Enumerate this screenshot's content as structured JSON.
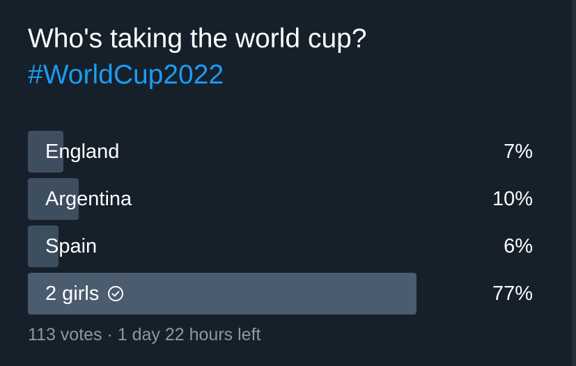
{
  "tweet": {
    "line1": "Who's taking the world cup?",
    "hashtag": "#WorldCup2022"
  },
  "poll": {
    "options": [
      {
        "label": "England",
        "percent_text": "7%",
        "percent": 7,
        "winner": false
      },
      {
        "label": "Argentina",
        "percent_text": "10%",
        "percent": 10,
        "winner": false
      },
      {
        "label": "Spain",
        "percent_text": "6%",
        "percent": 6,
        "winner": false
      },
      {
        "label": "2 girls",
        "percent_text": "77%",
        "percent": 77,
        "winner": true,
        "icon": "check-circle-icon"
      }
    ],
    "meta": "113 votes · 1 day 22 hours left"
  },
  "colors": {
    "background": "#15202b",
    "hashtag": "#1d9bf0",
    "bar": "#3d4f5f",
    "winner_bar": "#4a5c6e",
    "meta_text": "#8b98a5"
  }
}
